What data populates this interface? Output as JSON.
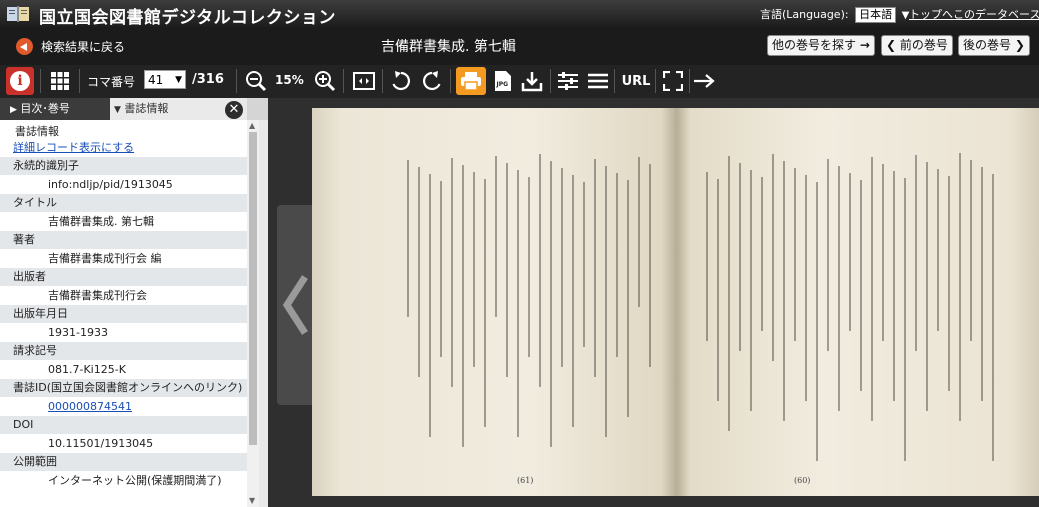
{
  "header": {
    "site_title": "国立国会図書館デジタルコレクション",
    "language_label": "言語(Language):",
    "language_value": "日本語",
    "top_link": "トップへ",
    "about_link": "このデータベースに"
  },
  "titlebar": {
    "back_label": "検索結果に戻る",
    "book_title": "吉備群書集成. 第七輯",
    "other_issue": "他の巻号を探す",
    "prev_issue": "前の巻号",
    "next_issue": "後の巻号"
  },
  "toolbar": {
    "koma_label": "コマ番号",
    "koma_value": "41",
    "koma_total": "/316",
    "zoom": "15%",
    "url_label": "URL"
  },
  "panel": {
    "tab_toc": "目次･巻号",
    "tab_info": "書誌情報",
    "heading": "書誌情報",
    "detail_link": "詳細レコード表示にする",
    "fields": [
      {
        "label": "永続的識別子",
        "value": "info:ndljp/pid/1913045"
      },
      {
        "label": "タイトル",
        "value": "吉備群書集成. 第七輯"
      },
      {
        "label": "著者",
        "value": "吉備群書集成刊行会 編"
      },
      {
        "label": "出版者",
        "value": "吉備群書集成刊行会"
      },
      {
        "label": "出版年月日",
        "value": "1931-1933"
      },
      {
        "label": "請求記号",
        "value": "081.7-Ki125-K"
      },
      {
        "label": "書誌ID(国立国会図書館オンラインへのリンク)",
        "value": "000000874541",
        "link": true
      },
      {
        "label": "DOI",
        "value": "10.11501/1913045"
      },
      {
        "label": "公開範囲",
        "value": "インターネット公開(保護期間満了)"
      }
    ]
  },
  "viewer": {
    "left_page_number": "(61)",
    "right_page_number": "(60)"
  },
  "icons": [
    "library-logo",
    "back-icon",
    "info-icon",
    "thumbnail-grid-icon",
    "zoom-out-icon",
    "zoom-in-icon",
    "fit-icon",
    "rotate-left-icon",
    "rotate-right-icon",
    "print-icon",
    "jpeg-icon",
    "download-icon",
    "settings-icon",
    "menu-icon",
    "fullscreen-icon",
    "arrow-right-icon",
    "close-icon",
    "prev-page-arrow"
  ],
  "colors": {
    "accent_red": "#c9322b",
    "print_orange": "#f59a20",
    "back_orange": "#e05a2b",
    "link_blue": "#1a4fb8"
  }
}
